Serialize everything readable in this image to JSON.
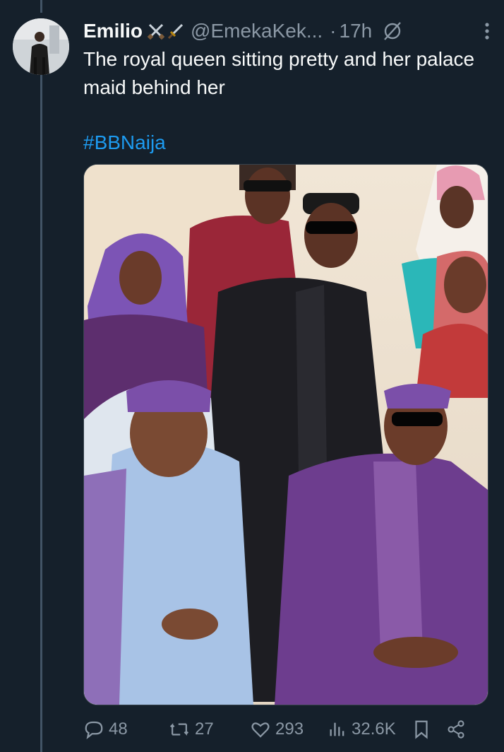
{
  "tweet": {
    "author_name": "Emilio",
    "author_emojis": "⚔️🗡️",
    "author_handle": "@EmekaKek...",
    "dot": "·",
    "time": "17h",
    "text": "The royal queen sitting pretty and her palace maid behind her",
    "hashtag": "#BBNaija",
    "media_icon": "photo",
    "stats": {
      "replies": "48",
      "reposts": "27",
      "likes": "293",
      "views": "32.6K"
    }
  },
  "icons": {
    "grok": "grok-icon",
    "more": "more-icon",
    "reply": "reply-icon",
    "repost": "repost-icon",
    "like": "heart-icon",
    "views": "views-icon",
    "bookmark": "bookmark-icon",
    "share": "share-icon"
  },
  "colors": {
    "background": "#15202b",
    "text": "#f7f9f9",
    "muted": "#8b98a5",
    "link": "#1d9bf0",
    "divider": "#425466"
  }
}
